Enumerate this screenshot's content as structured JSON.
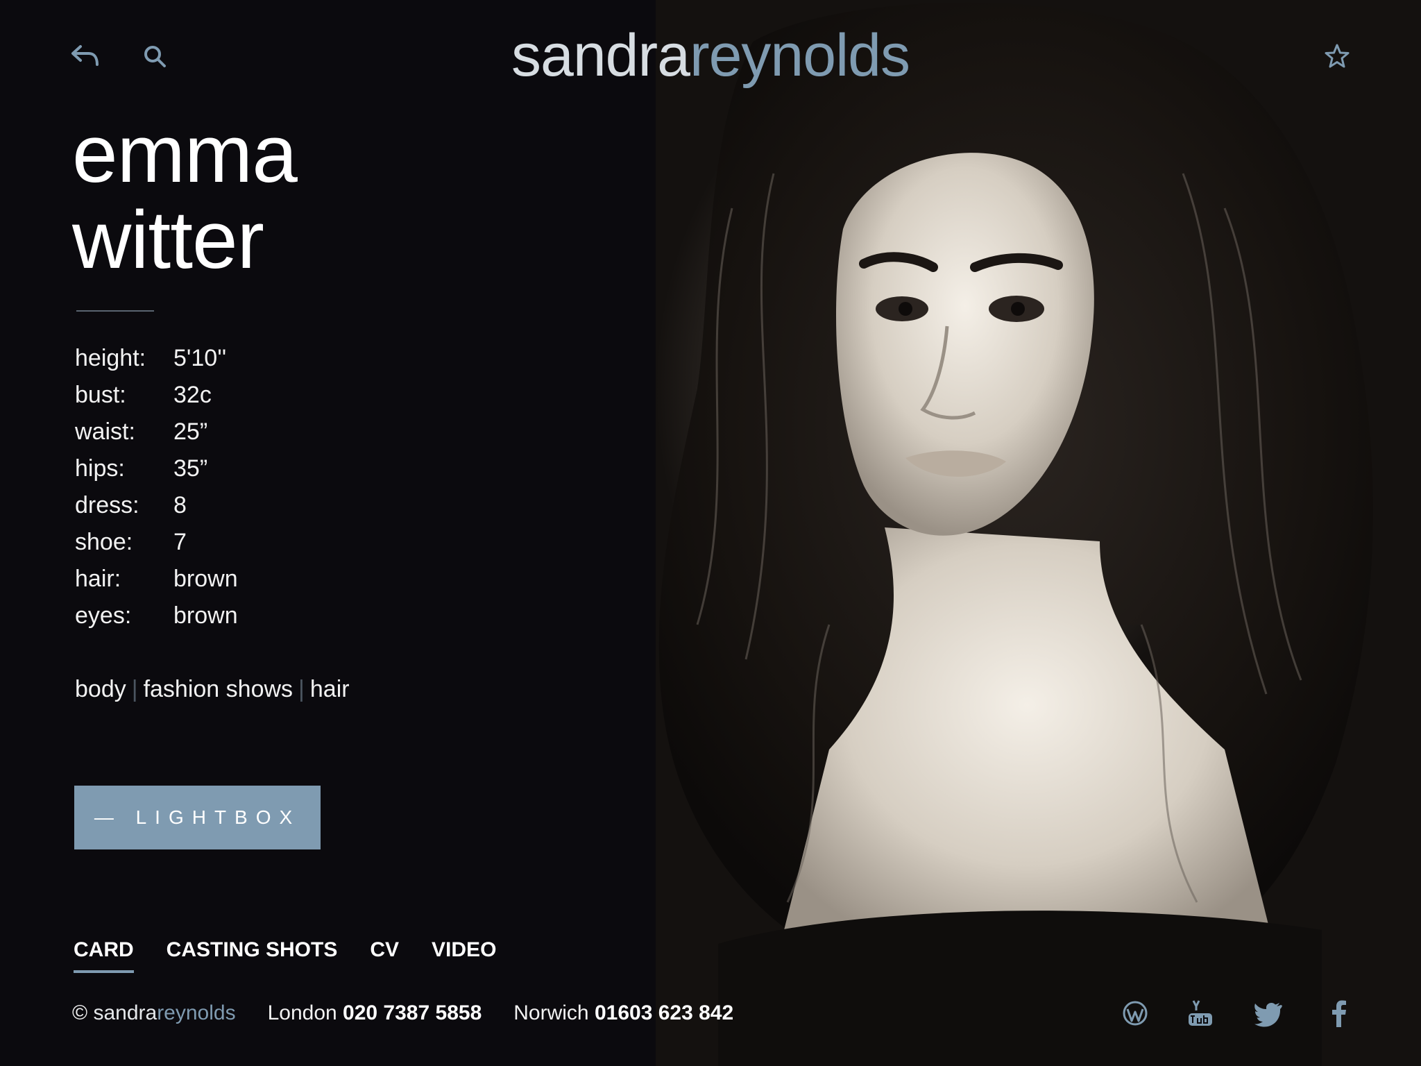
{
  "logo": {
    "part1": "sandra",
    "part2": "reynolds"
  },
  "model": {
    "first_name": "emma",
    "last_name": "witter"
  },
  "stats": [
    {
      "label": "height:",
      "value": "5'10''"
    },
    {
      "label": "bust:",
      "value": "32c"
    },
    {
      "label": "waist:",
      "value": "25”"
    },
    {
      "label": "hips:",
      "value": "35”"
    },
    {
      "label": "dress:",
      "value": "8"
    },
    {
      "label": "shoe:",
      "value": "7"
    },
    {
      "label": "hair:",
      "value": "brown"
    },
    {
      "label": "eyes:",
      "value": "brown"
    }
  ],
  "categories": [
    "body",
    "fashion shows",
    "hair"
  ],
  "lightbox_label": "— LIGHTBOX",
  "tabs": [
    {
      "label": "CARD",
      "active": true
    },
    {
      "label": "CASTING SHOTS",
      "active": false
    },
    {
      "label": "CV",
      "active": false
    },
    {
      "label": "VIDEO",
      "active": false
    }
  ],
  "footer": {
    "copyright": "©",
    "brand1": "sandra",
    "brand2": "reynolds",
    "london_label": "London",
    "london_phone": "020 7387 5858",
    "norwich_label": "Norwich",
    "norwich_phone": "01603 623 842"
  },
  "icons": {
    "back": "back-arrow-icon",
    "search": "search-icon",
    "favourite": "star-icon",
    "social": [
      "wordpress-icon",
      "youtube-icon",
      "twitter-icon",
      "facebook-icon"
    ]
  },
  "colors": {
    "accent": "#7f9bb1",
    "background": "#0b0a0e",
    "text": "#ffffff"
  }
}
